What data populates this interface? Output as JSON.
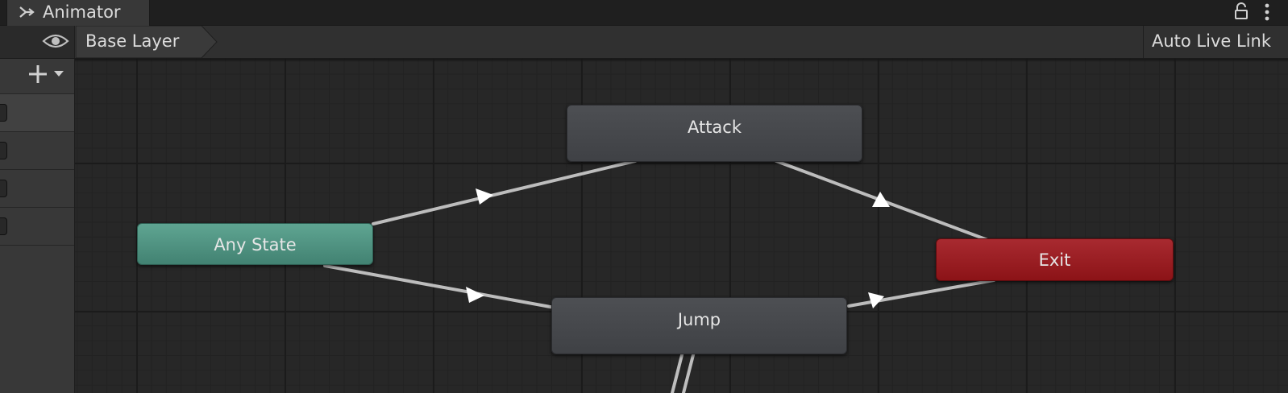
{
  "window": {
    "tab_label": "Animator",
    "tab_icon": "animator-transition-icon",
    "lock_icon": "padlock-icon",
    "menu_icon": "vertical-ellipsis-icon"
  },
  "toolbar": {
    "visibility_icon": "eye-icon",
    "breadcrumb": "Base Layer",
    "auto_live_link": "Auto Live Link"
  },
  "left_panel": {
    "add_icon": "plus-icon",
    "dropdown_icon": "caret-down-icon"
  },
  "graph": {
    "states": {
      "any_state": "Any State",
      "attack": "Attack",
      "jump": "Jump",
      "exit": "Exit"
    },
    "colors": {
      "any_state": "#4f9483",
      "default_state": "#46484c",
      "exit": "#9b1d22",
      "transition": "#bdbdbd",
      "grid_background": "#272727"
    }
  }
}
